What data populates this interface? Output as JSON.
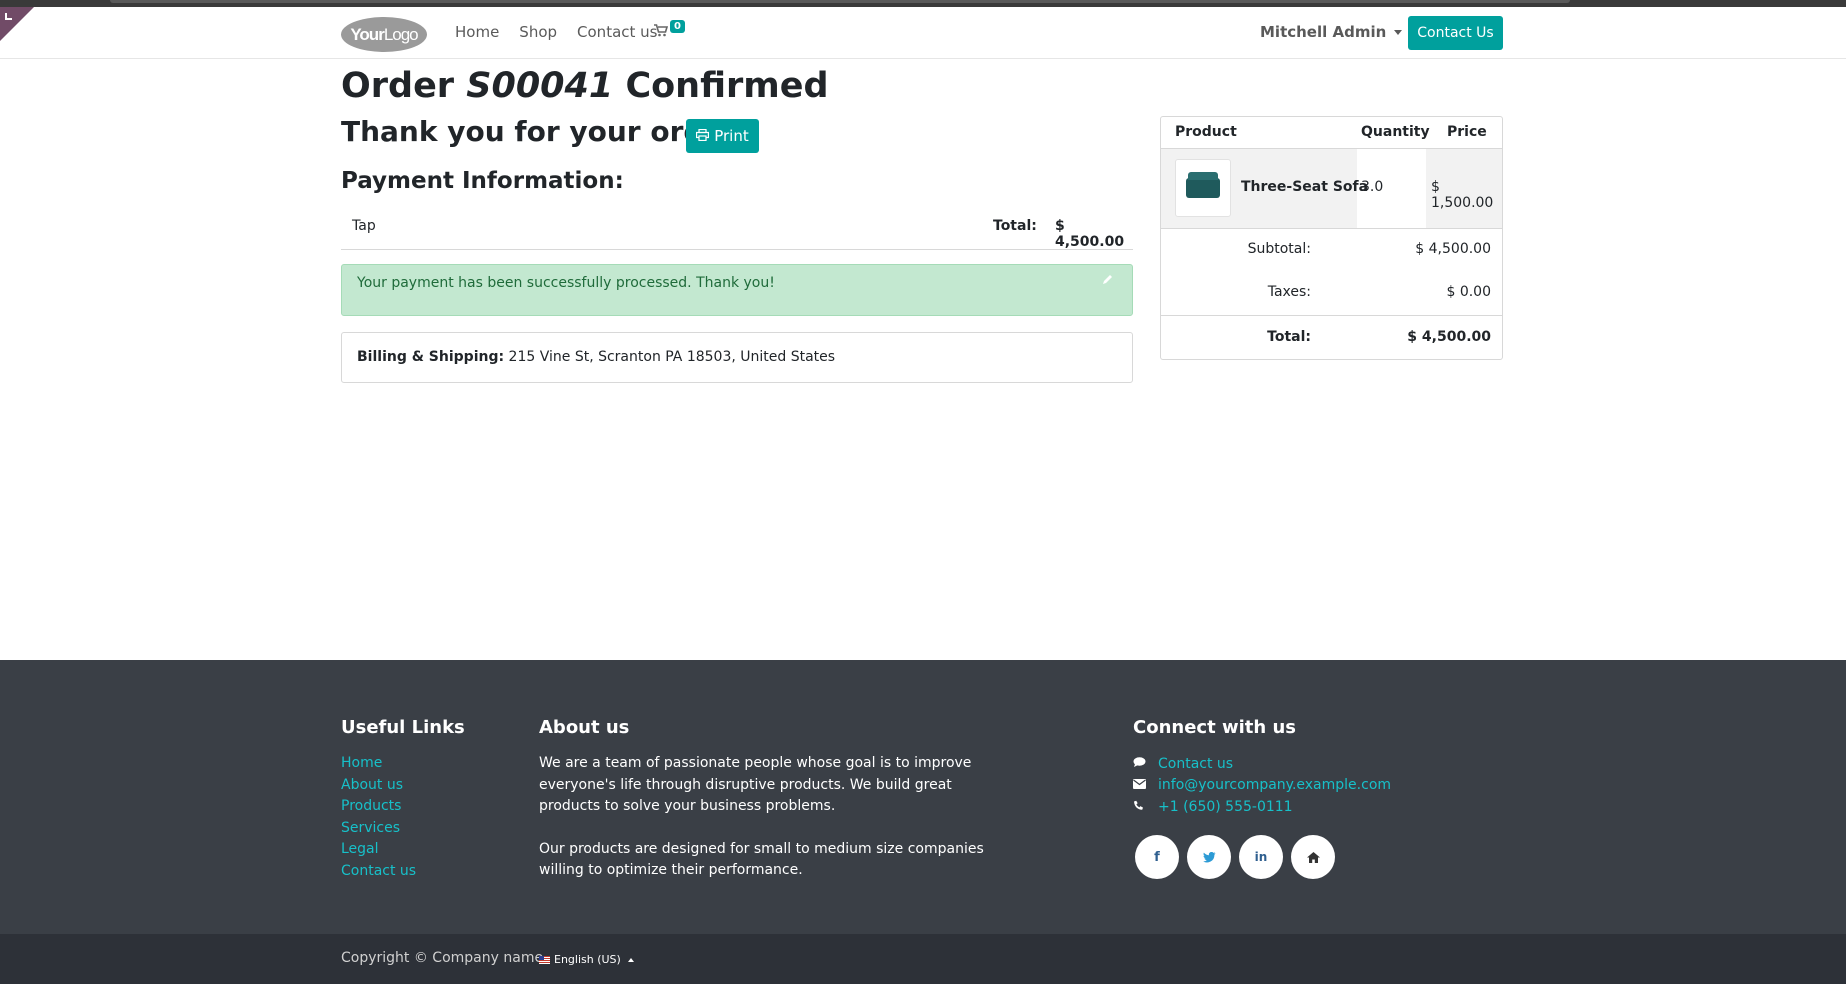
{
  "header": {
    "logo_bold": "Your",
    "logo_thin": "Logo",
    "nav": [
      "Home",
      "Shop",
      "Contact us"
    ],
    "cart_count": "0",
    "user": "Mitchell Admin",
    "contact_button": "Contact Us",
    "accent_color": "#00a09d"
  },
  "order": {
    "prefix": "Order",
    "number": "S00041",
    "suffix": "Confirmed",
    "thanks": "Thank you for your order.",
    "print_label": "Print"
  },
  "payment": {
    "heading": "Payment Information:",
    "method": "Tap",
    "total_label": "Total:",
    "total_value": "$ 4,500.00",
    "success_message": "Your payment has been successfully processed. Thank you!"
  },
  "billing": {
    "label": "Billing & Shipping:",
    "address": "215 Vine St, Scranton PA 18503, United States"
  },
  "summary": {
    "headers": [
      "Product",
      "Quantity",
      "Price"
    ],
    "product": {
      "name": "Three-Seat Sofa",
      "quantity": "3.0",
      "price": "$ 1,500.00"
    },
    "subtotal_label": "Subtotal:",
    "subtotal_value": "$ 4,500.00",
    "taxes_label": "Taxes:",
    "taxes_value": "$ 0.00",
    "total_label": "Total:",
    "total_value": "$ 4,500.00"
  },
  "footer": {
    "useful_links_title": "Useful Links",
    "useful_links": [
      "Home",
      "About us",
      "Products",
      "Services",
      "Legal",
      "Contact us"
    ],
    "about_title": "About us",
    "about_p1": "We are a team of passionate people whose goal is to improve everyone's life through disruptive products. We build great products to solve your business problems.",
    "about_p2": "Our products are designed for small to medium size companies willing to optimize their performance.",
    "connect_title": "Connect with us",
    "connect": {
      "contact": "Contact us",
      "email": "info@yourcompany.example.com",
      "phone": "+1 (650) 555-0111"
    },
    "socials": [
      "facebook-icon",
      "twitter-icon",
      "linkedin-icon",
      "home-icon"
    ],
    "copyright": "Copyright © Company name",
    "language": "English (US)"
  }
}
